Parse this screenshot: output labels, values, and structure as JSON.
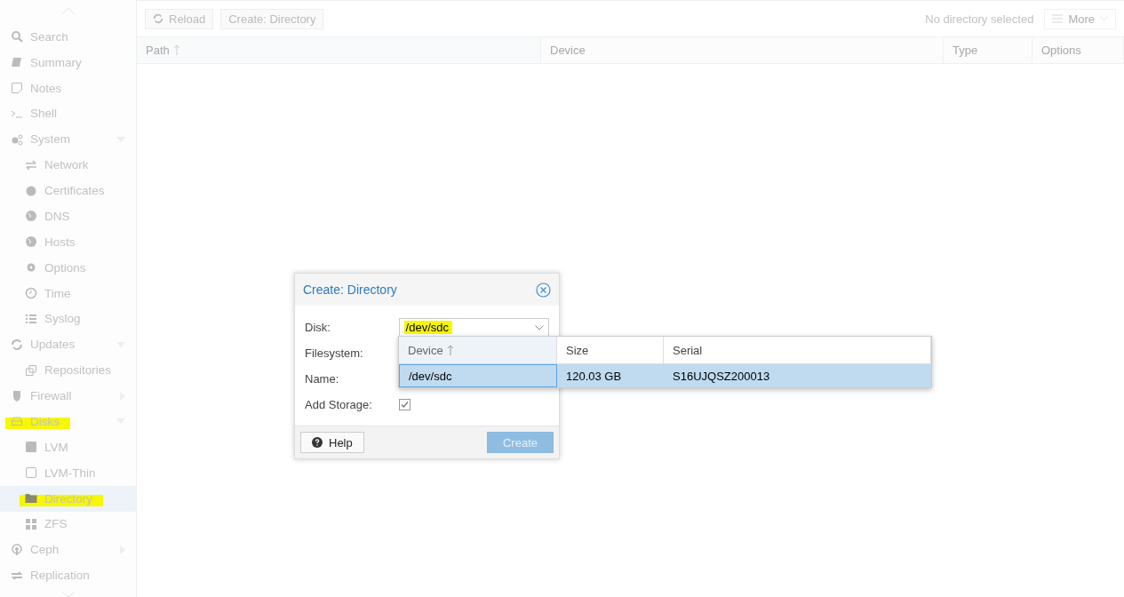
{
  "sidebar": {
    "items": [
      {
        "label": "Search",
        "selected": false,
        "highlighted": false
      },
      {
        "label": "Summary",
        "selected": false,
        "highlighted": false
      },
      {
        "label": "Notes",
        "selected": false,
        "highlighted": false
      },
      {
        "label": "Shell",
        "selected": false,
        "highlighted": false
      },
      {
        "label": "System",
        "selected": false,
        "highlighted": false,
        "expanded": true,
        "children": [
          {
            "label": "Network",
            "selected": false,
            "highlighted": false
          },
          {
            "label": "Certificates",
            "selected": false,
            "highlighted": false
          },
          {
            "label": "DNS",
            "selected": false,
            "highlighted": false
          },
          {
            "label": "Hosts",
            "selected": false,
            "highlighted": false
          },
          {
            "label": "Options",
            "selected": false,
            "highlighted": false
          },
          {
            "label": "Time",
            "selected": false,
            "highlighted": false
          },
          {
            "label": "Syslog",
            "selected": false,
            "highlighted": false
          }
        ]
      },
      {
        "label": "Updates",
        "selected": false,
        "highlighted": false,
        "expanded": true,
        "children": [
          {
            "label": "Repositories",
            "selected": false,
            "highlighted": false
          }
        ]
      },
      {
        "label": "Firewall",
        "selected": false,
        "highlighted": false,
        "expanded": false
      },
      {
        "label": "Disks",
        "selected": false,
        "highlighted": true,
        "expanded": true,
        "children": [
          {
            "label": "LVM",
            "selected": false,
            "highlighted": false
          },
          {
            "label": "LVM-Thin",
            "selected": false,
            "highlighted": false
          },
          {
            "label": "Directory",
            "selected": true,
            "highlighted": true
          },
          {
            "label": "ZFS",
            "selected": false,
            "highlighted": false
          }
        ]
      },
      {
        "label": "Ceph",
        "selected": false,
        "highlighted": false,
        "expanded": false
      },
      {
        "label": "Replication",
        "selected": false,
        "highlighted": false
      }
    ]
  },
  "toolbar": {
    "buttons": [
      "Reload",
      "Create: Directory"
    ],
    "status": "No directory selected",
    "menu": {
      "label": "More",
      "disabled": true
    }
  },
  "table": {
    "columns": [
      {
        "label": "Path",
        "sorted": true
      },
      {
        "label": "Device",
        "sorted": false
      },
      {
        "label": "Type",
        "sorted": false
      },
      {
        "label": "Options",
        "sorted": false
      }
    ]
  },
  "dialog": {
    "title": "Create: Directory",
    "fields": [
      {
        "kind": "combo",
        "label": "Disk:",
        "value": "/dev/sdc",
        "highlighted": true
      },
      {
        "kind": "text",
        "label": "Filesystem:"
      },
      {
        "kind": "text",
        "label": "Name:"
      },
      {
        "kind": "checkbox",
        "label": "Add Storage:",
        "checked": true
      }
    ],
    "help": "Help",
    "submit": {
      "label": "Create",
      "disabled": true
    }
  },
  "dropdown": {
    "columns": [
      {
        "label": "Device",
        "sorted": true
      },
      {
        "label": "Size",
        "sorted": false
      },
      {
        "label": "Serial",
        "sorted": false
      }
    ],
    "rows": [
      {
        "cells": [
          "/dev/sdc",
          "120.03 GB",
          "S16UJQSZ200013"
        ],
        "selected": true
      }
    ]
  }
}
